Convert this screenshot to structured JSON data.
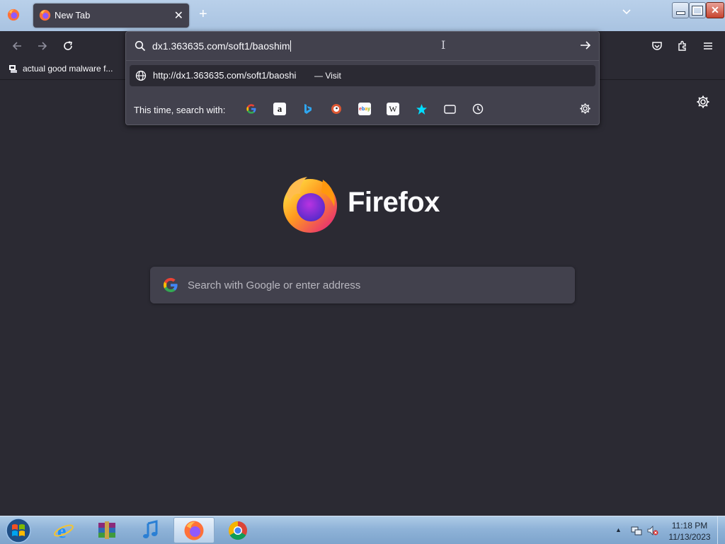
{
  "tabs": [
    {
      "title": "New Tab"
    }
  ],
  "bookmarks": [
    {
      "label": "actual good malware f..."
    }
  ],
  "urlbar": {
    "value": "dx1.363635.com/soft1/baoshim",
    "suggestion_url": "http://dx1.363635.com/soft1/baoshi",
    "suggestion_action": "— Visit",
    "search_with_label": "This time, search with:",
    "engines": [
      "google-icon",
      "amazon-icon",
      "bing-icon",
      "duckduckgo-icon",
      "ebay-icon",
      "wikipedia-icon",
      "bookmarks-icon",
      "tabs-icon",
      "history-icon"
    ]
  },
  "page": {
    "brand": "Firefox",
    "search_placeholder": "Search with Google or enter address"
  },
  "taskbar": {
    "apps": [
      "internet-explorer-icon",
      "winrar-icon",
      "itunes-icon",
      "firefox-icon",
      "chrome-icon"
    ],
    "active_app": "firefox-icon",
    "time": "11:18 PM",
    "date": "11/13/2023"
  },
  "colors": {
    "accent": "#00ddff",
    "chrome": "#2b2a33",
    "panel": "#42414d"
  }
}
